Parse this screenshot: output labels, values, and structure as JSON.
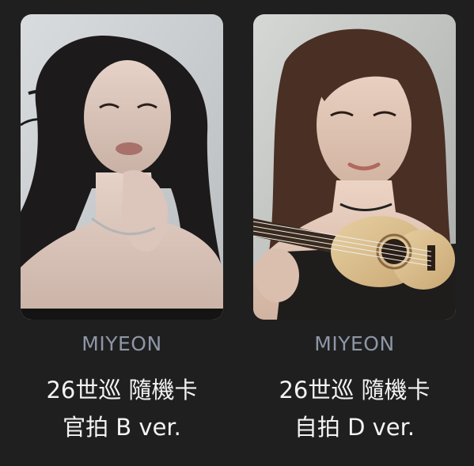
{
  "cards": [
    {
      "member": "MIYEON",
      "line1": "26世巡 隨機卡",
      "line2": "官拍 B ver.",
      "photo_icon": "portrait-photo"
    },
    {
      "member": "MIYEON",
      "line1": "26世巡 隨機卡",
      "line2": "自拍 D ver.",
      "photo_icon": "selfie-with-ukulele-photo"
    }
  ],
  "colors": {
    "background": "#1f1f1f",
    "member_text": "#8e96a6",
    "title_text": "#f3f3f3"
  }
}
